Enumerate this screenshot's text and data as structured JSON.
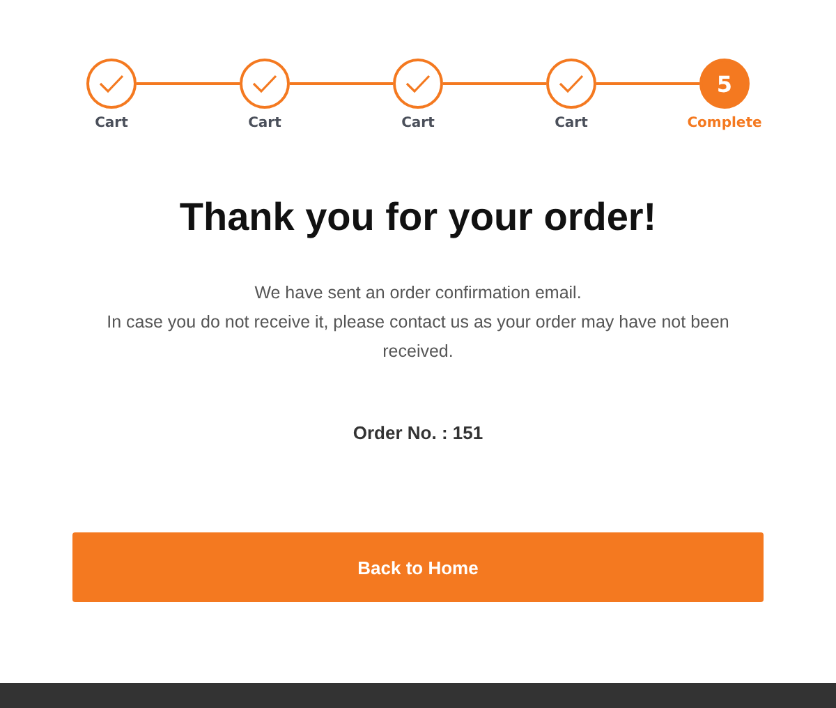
{
  "steps": [
    {
      "label": "Cart",
      "kind": "done"
    },
    {
      "label": "Cart",
      "kind": "done"
    },
    {
      "label": "Cart",
      "kind": "done"
    },
    {
      "label": "Cart",
      "kind": "done"
    },
    {
      "label": "Complete",
      "kind": "current",
      "number": "5"
    }
  ],
  "title": "Thank you for your order!",
  "message": [
    "We have sent an order confirmation email.",
    "In case you do not receive it, please contact us as your order may have not been received."
  ],
  "order_number": "Order No. : 151",
  "button": "Back to Home"
}
